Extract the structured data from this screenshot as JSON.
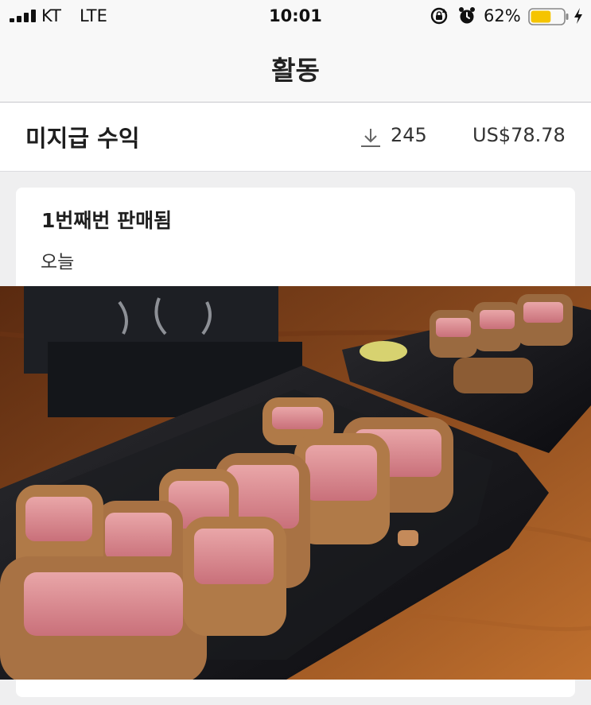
{
  "status_bar": {
    "carrier": "KT",
    "network": "LTE",
    "time": "10:01",
    "battery_percent": "62%",
    "battery_level": 0.62,
    "battery_color": "#f5c400",
    "icons": [
      "signal-icon",
      "rotation-lock-icon",
      "alarm-icon",
      "battery-icon",
      "charging-icon"
    ]
  },
  "nav": {
    "title": "활동"
  },
  "earnings": {
    "label": "미지급 수익",
    "download_count": "245",
    "amount": "US$78.78",
    "icon": "download-icon"
  },
  "sale": {
    "title": "1번째번 판매됨",
    "date": "오늘",
    "photo_subject": "katsu-on-black-plate"
  }
}
